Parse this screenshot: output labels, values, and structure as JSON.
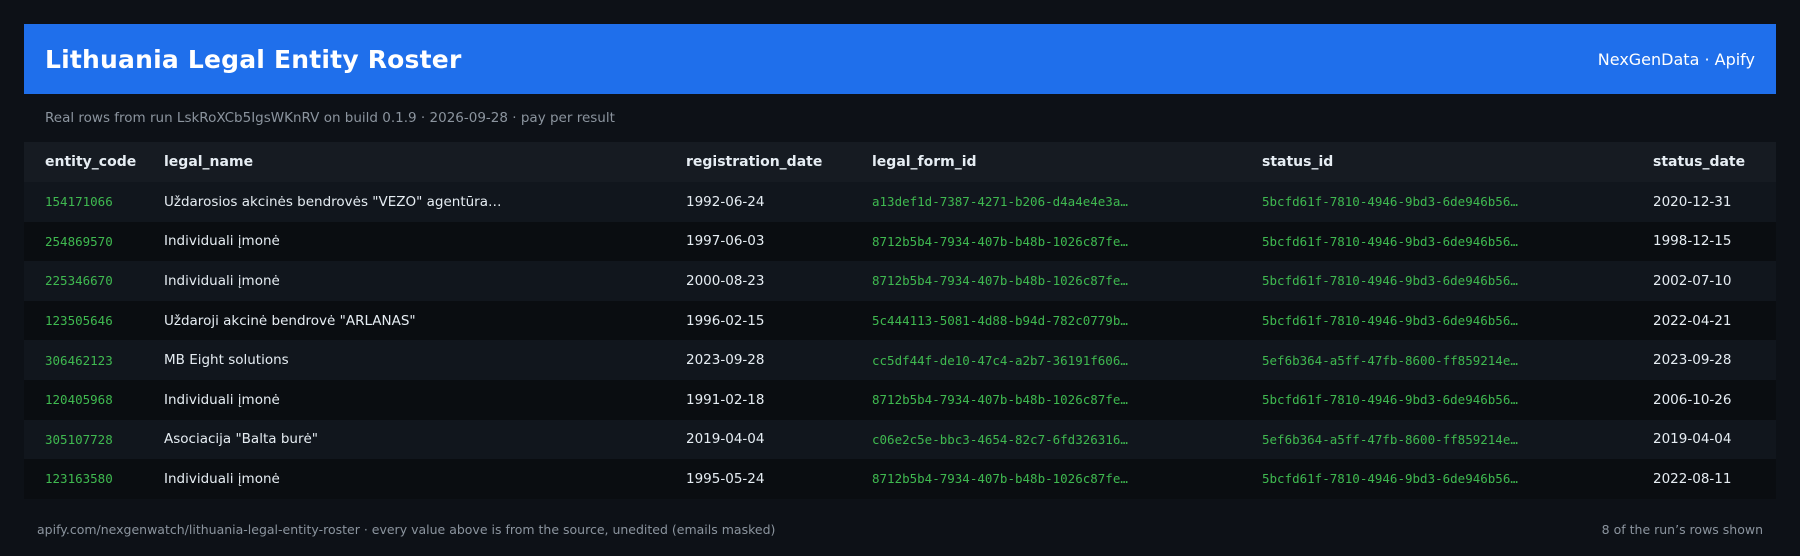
{
  "header": {
    "title": "Lithuania Legal Entity Roster",
    "brand": "NexGenData · Apify"
  },
  "subtitle": "Real rows from run LskRoXCb5IgsWKnRV on build 0.1.9 · 2026-09-28 · pay per result",
  "table": {
    "columns": [
      "entity_code",
      "legal_name",
      "registration_date",
      "legal_form_id",
      "status_id",
      "status_date"
    ],
    "rows": [
      [
        "154171066",
        "Uždarosios akcinės bendrovės \"VEZO\" agentūra…",
        "1992-06-24",
        "a13def1d-7387-4271-b206-d4a4e4e3a…",
        "5bcfd61f-7810-4946-9bd3-6de946b56…",
        "2020-12-31"
      ],
      [
        "254869570",
        "Individuali įmonė",
        "1997-06-03",
        "8712b5b4-7934-407b-b48b-1026c87fe…",
        "5bcfd61f-7810-4946-9bd3-6de946b56…",
        "1998-12-15"
      ],
      [
        "225346670",
        "Individuali įmonė",
        "2000-08-23",
        "8712b5b4-7934-407b-b48b-1026c87fe…",
        "5bcfd61f-7810-4946-9bd3-6de946b56…",
        "2002-07-10"
      ],
      [
        "123505646",
        "Uždaroji akcinė bendrovė \"ARLANAS\"",
        "1996-02-15",
        "5c444113-5081-4d88-b94d-782c0779b…",
        "5bcfd61f-7810-4946-9bd3-6de946b56…",
        "2022-04-21"
      ],
      [
        "306462123",
        "MB Eight solutions",
        "2023-09-28",
        "cc5df44f-de10-47c4-a2b7-36191f606…",
        "5ef6b364-a5ff-47fb-8600-ff859214e…",
        "2023-09-28"
      ],
      [
        "120405968",
        "Individuali įmonė",
        "1991-02-18",
        "8712b5b4-7934-407b-b48b-1026c87fe…",
        "5bcfd61f-7810-4946-9bd3-6de946b56…",
        "2006-10-26"
      ],
      [
        "305107728",
        "Asociacija \"Balta burė\"",
        "2019-04-04",
        "c06e2c5e-bbc3-4654-82c7-6fd326316…",
        "5ef6b364-a5ff-47fb-8600-ff859214e…",
        "2019-04-04"
      ],
      [
        "123163580",
        "Individuali įmonė",
        "1995-05-24",
        "8712b5b4-7934-407b-b48b-1026c87fe…",
        "5bcfd61f-7810-4946-9bd3-6de946b56…",
        "2022-08-11"
      ]
    ]
  },
  "footer": {
    "left": "apify.com/nexgenwatch/lithuania-legal-entity-roster  ·  every value above is from the source, unedited (emails masked)",
    "right": "8 of the run’s rows shown"
  },
  "colors": {
    "background": "#0d1117",
    "header": "#1f6feb",
    "mono_accent": "#3fb950"
  }
}
